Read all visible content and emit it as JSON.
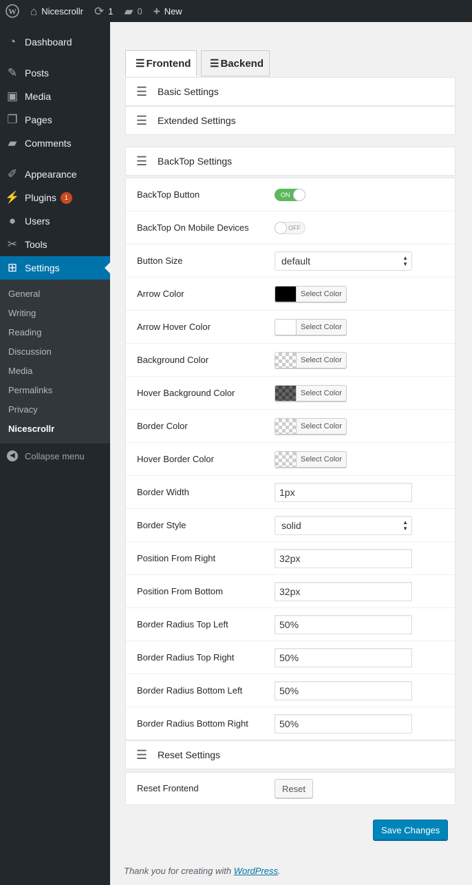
{
  "adminbar": {
    "site_name": "Nicescrollr",
    "updates_count": "1",
    "comments_count": "0",
    "new_label": "New"
  },
  "sidebar": {
    "items": [
      {
        "label": "Dashboard",
        "icon": "dashboard-icon"
      },
      {
        "label": "Posts",
        "icon": "pushpin-icon"
      },
      {
        "label": "Media",
        "icon": "media-icon"
      },
      {
        "label": "Pages",
        "icon": "pages-icon"
      },
      {
        "label": "Comments",
        "icon": "comment-icon"
      },
      {
        "label": "Appearance",
        "icon": "brush-icon"
      },
      {
        "label": "Plugins",
        "icon": "plugin-icon",
        "badge": "1"
      },
      {
        "label": "Users",
        "icon": "user-icon"
      },
      {
        "label": "Tools",
        "icon": "wrench-icon"
      },
      {
        "label": "Settings",
        "icon": "settings-icon"
      }
    ],
    "submenu": [
      "General",
      "Writing",
      "Reading",
      "Discussion",
      "Media",
      "Permalinks",
      "Privacy",
      "Nicescrollr"
    ],
    "collapse_label": "Collapse menu"
  },
  "tabs": [
    "Frontend",
    "Backend"
  ],
  "panels": {
    "basic": "Basic Settings",
    "extended": "Extended Settings",
    "backtop": "BackTop Settings",
    "reset": "Reset Settings"
  },
  "backtop_rows": {
    "button": {
      "label": "BackTop Button",
      "value": "ON"
    },
    "mobile": {
      "label": "BackTop On Mobile Devices",
      "value": "OFF"
    },
    "size": {
      "label": "Button Size",
      "value": "default"
    },
    "arrow_color": {
      "label": "Arrow Color",
      "button": "Select Color",
      "color": "#000000"
    },
    "arrow_hover_color": {
      "label": "Arrow Hover Color",
      "button": "Select Color",
      "color": "#ffffff"
    },
    "bg_color": {
      "label": "Background Color",
      "button": "Select Color"
    },
    "hover_bg_color": {
      "label": "Hover Background Color",
      "button": "Select Color"
    },
    "border_color": {
      "label": "Border Color",
      "button": "Select Color"
    },
    "hover_border_color": {
      "label": "Hover Border Color",
      "button": "Select Color"
    },
    "border_width": {
      "label": "Border Width",
      "value": "1px"
    },
    "border_style": {
      "label": "Border Style",
      "value": "solid"
    },
    "pos_right": {
      "label": "Position From Right",
      "value": "32px"
    },
    "pos_bottom": {
      "label": "Position From Bottom",
      "value": "32px"
    },
    "radius_tl": {
      "label": "Border Radius Top Left",
      "value": "50%"
    },
    "radius_tr": {
      "label": "Border Radius Top Right",
      "value": "50%"
    },
    "radius_bl": {
      "label": "Border Radius Bottom Left",
      "value": "50%"
    },
    "radius_br": {
      "label": "Border Radius Bottom Right",
      "value": "50%"
    }
  },
  "reset": {
    "label": "Reset Frontend",
    "button": "Reset"
  },
  "save_label": "Save Changes",
  "footer": {
    "text": "Thank you for creating with ",
    "link": "WordPress",
    "end": "."
  },
  "colors": {
    "sidebar_bg": "#23282d",
    "accent": "#0073aa",
    "primary_button": "#0085ba",
    "toggle_on": "#5cb85c"
  }
}
